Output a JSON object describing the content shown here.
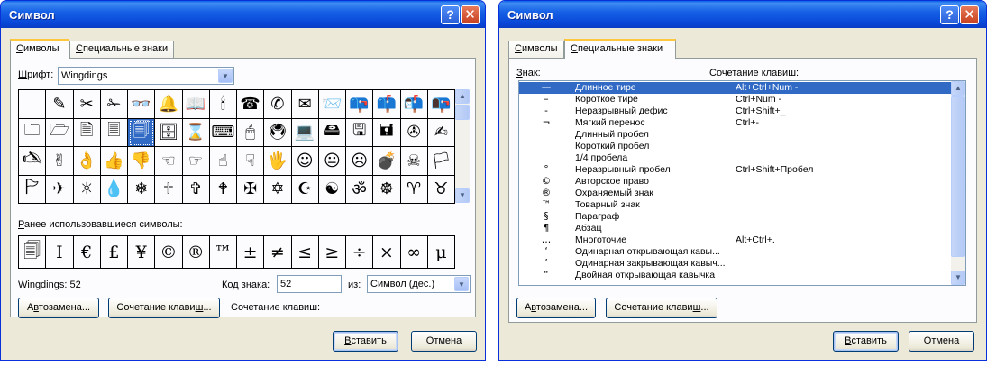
{
  "dialog1": {
    "title": "Символ",
    "help_icon": "help-icon",
    "close_icon": "close-icon",
    "tabs": [
      {
        "label_key": "С",
        "label_rest": "имволы",
        "active": true
      },
      {
        "label_key": "С",
        "label_rest": "пециальные знаки",
        "active": false
      }
    ],
    "font_label_key": "Ш",
    "font_label_rest": "рифт:",
    "font_value": "Wingdings",
    "symbols": [
      " ",
      "✎",
      "✂",
      "✁",
      "👓",
      "🔔",
      "📖",
      "🕯",
      "☎",
      "✆",
      "✉",
      "📨",
      "📪",
      "📫",
      "📬",
      "📭",
      "🗀",
      "🗁",
      "🗎",
      "🗏",
      "🗐",
      "🗄",
      "⌛",
      "⌨",
      "🖱",
      "🖲",
      "💻",
      "🖴",
      "🖫",
      "🖬",
      "✇",
      "✍",
      "🖎",
      "✌",
      "👌",
      "👍",
      "👎",
      "☜",
      "☞",
      "☝",
      "☟",
      "🖐",
      "☺",
      "😐",
      "☹",
      "💣",
      "☠",
      "🏳",
      "🏱",
      "✈",
      "☼",
      "💧",
      "❄",
      "🕆",
      "✞",
      "🕈",
      "✠",
      "✡",
      "☪",
      "☯",
      "ॐ",
      "☸",
      "♈",
      "♉"
    ],
    "selected_symbol_index": 20,
    "recent_label_key": "Р",
    "recent_label_rest": "анее использовавшиеся символы:",
    "recent_symbols": [
      "🗐",
      "I",
      "€",
      "£",
      "¥",
      "©",
      "®",
      "™",
      "±",
      "≠",
      "≤",
      "≥",
      "÷",
      "×",
      "∞",
      "µ"
    ],
    "symbol_info": "Wingdings: 52",
    "code_label_key": "К",
    "code_label_rest": "од знака:",
    "code_value": "52",
    "from_label_key": "и",
    "from_label_rest": "з:",
    "from_value": "Символ (дес.)",
    "autocorrect_key": "в",
    "autocorrect_pre": "А",
    "autocorrect_rest": "тозамена...",
    "shortcut_key_key": "ш",
    "shortcut_key_pre": "Сочетание клави",
    "shortcut_key_rest": "...",
    "shortcut_label": "Сочетание клавиш:",
    "insert_key": "В",
    "insert_rest": "ставить",
    "cancel_label": "Отмена"
  },
  "dialog2": {
    "title": "Символ",
    "help_icon": "help-icon",
    "close_icon": "close-icon",
    "tabs": [
      {
        "label_key": "С",
        "label_rest": "имволы",
        "active": false
      },
      {
        "label_key": "С",
        "label_rest": "пециальные знаки",
        "active": true
      }
    ],
    "col_sign_key": "З",
    "col_sign_rest": "нак:",
    "col_shortcut": "Сочетание клавиш:",
    "rows": [
      {
        "sym": "—",
        "name": "Длинное тире",
        "keys": "Alt+Ctrl+Num -",
        "selected": true
      },
      {
        "sym": "–",
        "name": "Короткое тире",
        "keys": "Ctrl+Num -",
        "selected": false
      },
      {
        "sym": "‑",
        "name": "Неразрывный дефис",
        "keys": "Ctrl+Shift+_",
        "selected": false
      },
      {
        "sym": "¬",
        "name": "Мягкий перенос",
        "keys": "Ctrl+-",
        "selected": false
      },
      {
        "sym": "",
        "name": "Длинный пробел",
        "keys": "",
        "selected": false
      },
      {
        "sym": "",
        "name": "Короткий пробел",
        "keys": "",
        "selected": false
      },
      {
        "sym": "",
        "name": "1/4 пробела",
        "keys": "",
        "selected": false
      },
      {
        "sym": "°",
        "name": "Неразрывный пробел",
        "keys": "Ctrl+Shift+Пробел",
        "selected": false
      },
      {
        "sym": "©",
        "name": "Авторское право",
        "keys": "",
        "selected": false
      },
      {
        "sym": "®",
        "name": "Охраняемый знак",
        "keys": "",
        "selected": false
      },
      {
        "sym": "™",
        "name": "Товарный знак",
        "keys": "",
        "selected": false
      },
      {
        "sym": "§",
        "name": "Параграф",
        "keys": "",
        "selected": false
      },
      {
        "sym": "¶",
        "name": "Абзац",
        "keys": "",
        "selected": false
      },
      {
        "sym": "…",
        "name": "Многоточие",
        "keys": "Alt+Ctrl+.",
        "selected": false
      },
      {
        "sym": "‘",
        "name": "Одинарная открывающая кавы...",
        "keys": "",
        "selected": false
      },
      {
        "sym": "’",
        "name": "Одинарная закрывающая кавыч...",
        "keys": "",
        "selected": false
      },
      {
        "sym": "“",
        "name": "Двойная открывающая кавычка",
        "keys": "",
        "selected": false
      }
    ],
    "autocorrect_key": "в",
    "autocorrect_pre": "А",
    "autocorrect_rest": "тозамена...",
    "shortcut_key_key": "ш",
    "shortcut_key_pre": "Сочетание клави",
    "shortcut_key_rest": "...",
    "insert_key": "В",
    "insert_rest": "ставить",
    "cancel_label": "Отмена"
  }
}
